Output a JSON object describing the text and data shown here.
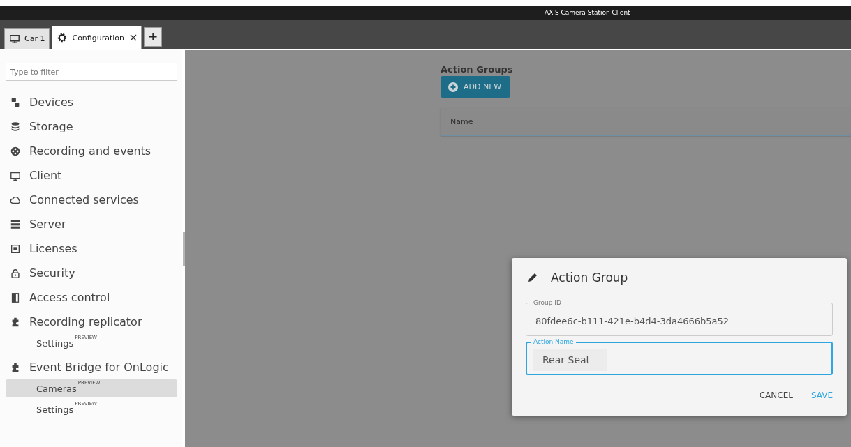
{
  "window": {
    "title": "AXIS Camera Station Client"
  },
  "tabs": [
    {
      "label": "Car 1",
      "selected": false,
      "closable": false
    },
    {
      "label": "Configuration",
      "selected": true,
      "closable": true
    }
  ],
  "add_tab": {
    "label": "+"
  },
  "sidebar": {
    "filter": {
      "placeholder": "Type to filter"
    },
    "items": [
      {
        "label": "Devices",
        "selected": false
      },
      {
        "label": "Storage",
        "selected": false
      },
      {
        "label": "Recording and events",
        "selected": false
      },
      {
        "label": "Client",
        "selected": false
      },
      {
        "label": "Connected services",
        "selected": false
      },
      {
        "label": "Server",
        "selected": false
      },
      {
        "label": "Licenses",
        "selected": false
      },
      {
        "label": "Security",
        "selected": false
      },
      {
        "label": "Access control",
        "selected": false
      },
      {
        "label": "Recording replicator",
        "selected": false,
        "children": [
          {
            "label": "Settings",
            "badge": "PREVIEW",
            "selected": false
          }
        ]
      },
      {
        "label": "Event Bridge for OnLogic",
        "selected": false,
        "children": [
          {
            "label": "Cameras",
            "badge": "PREVIEW",
            "selected": true
          },
          {
            "label": "Settings",
            "badge": "PREVIEW",
            "selected": false
          }
        ]
      }
    ]
  },
  "main": {
    "heading": "Action Groups",
    "add_button": "ADD NEW",
    "table": {
      "columns": [
        "Name"
      ]
    }
  },
  "dialog": {
    "title": "Action Group",
    "fields": [
      {
        "label": "Group ID",
        "value": "80fdee6c-b111-421e-b4d4-3da4666b5a52",
        "focused": false
      },
      {
        "label": "Action Name",
        "value": "Rear Seat",
        "focused": true
      }
    ],
    "buttons": [
      {
        "label": "CANCEL",
        "kind": "secondary"
      },
      {
        "label": "SAVE",
        "kind": "primary"
      }
    ]
  }
}
